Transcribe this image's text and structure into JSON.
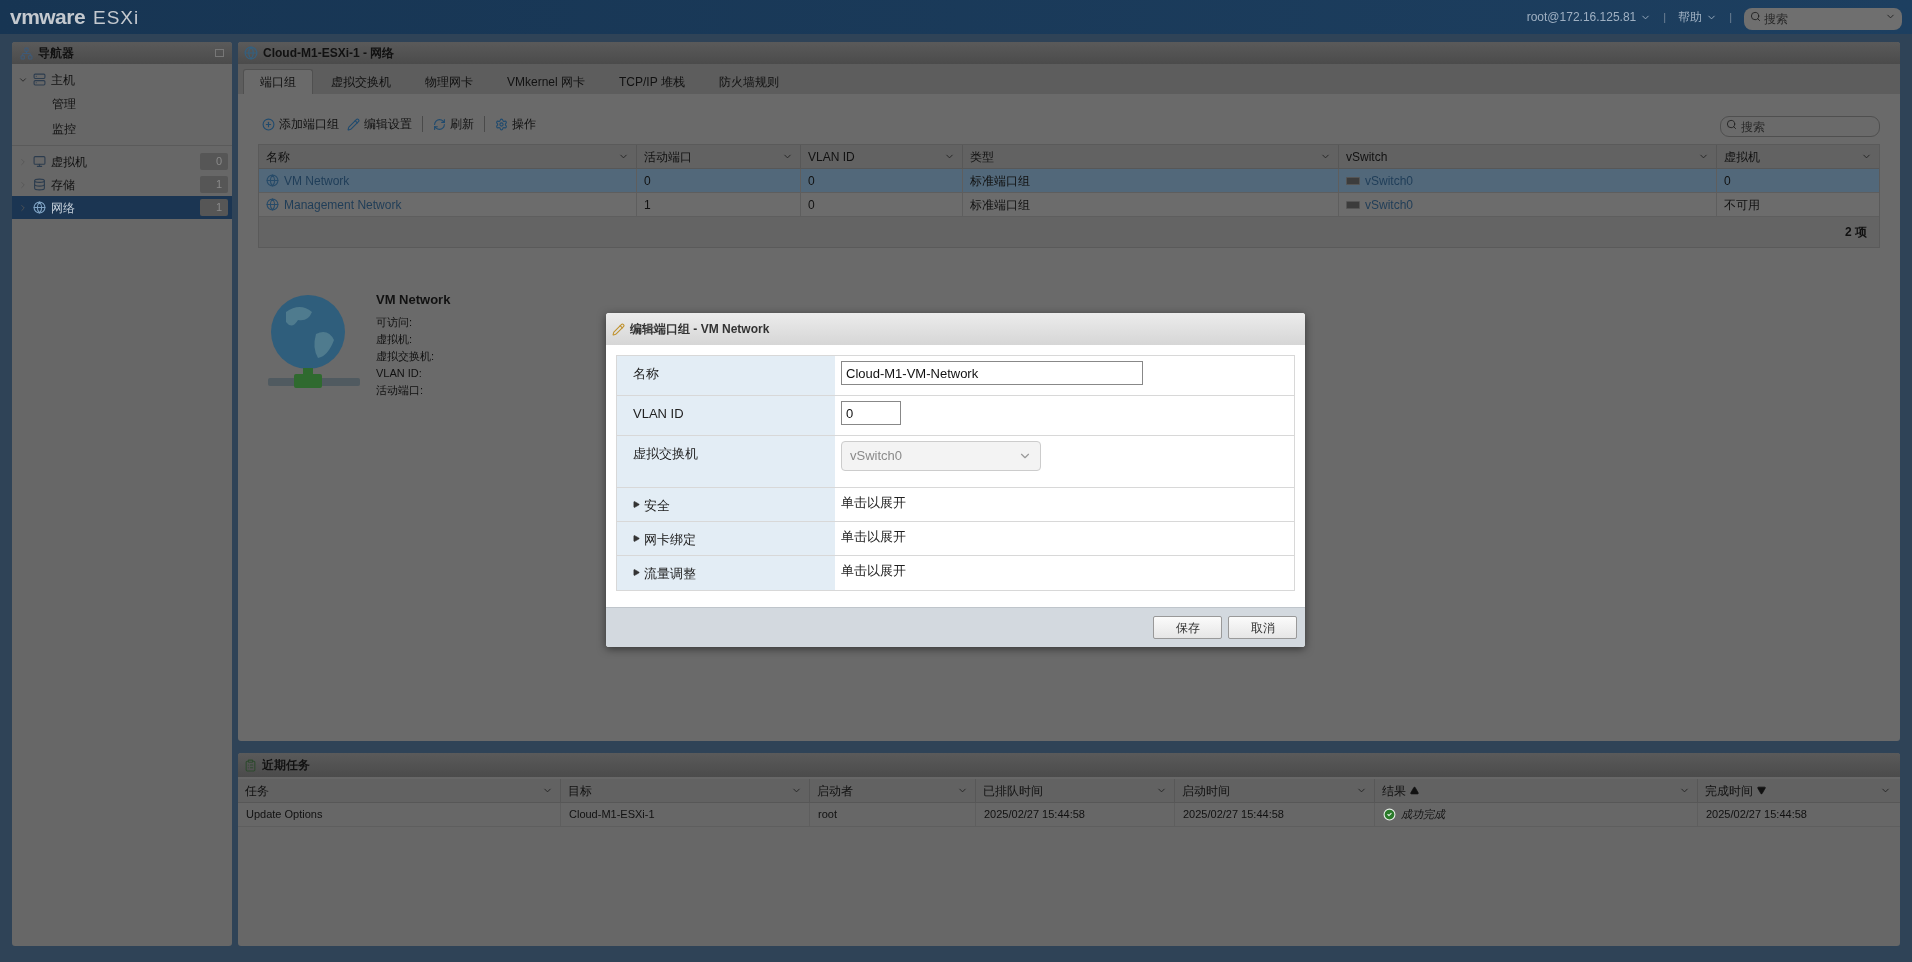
{
  "top_bar": {
    "logo": {
      "brand": "vmware",
      "product": "ESXi"
    },
    "items": [
      {
        "kind": "menu",
        "label": "root@172.16.125.81"
      },
      {
        "kind": "divider",
        "label": "|"
      },
      {
        "kind": "menu",
        "label": "帮助"
      },
      {
        "kind": "divider",
        "label": "|"
      }
    ],
    "search": {
      "placeholder": "搜索"
    }
  },
  "navigator": {
    "title": "导航器",
    "items": [
      {
        "label": "主机",
        "kind": "host",
        "expanded": true,
        "selected": false,
        "children": [
          {
            "label": "管理",
            "selected": false
          },
          {
            "label": "监控",
            "selected": false
          }
        ]
      },
      {
        "label": "虚拟机",
        "kind": "vm",
        "count": "0",
        "selected": false
      },
      {
        "label": "存储",
        "kind": "storage",
        "count": "1",
        "selected": false
      },
      {
        "label": "网络",
        "kind": "network",
        "count": "1",
        "selected": true
      }
    ]
  },
  "main": {
    "title": "Cloud-M1-ESXi-1 - 网络",
    "tabs": [
      {
        "label": "端口组",
        "selected": true
      },
      {
        "label": "虚拟交换机",
        "selected": false
      },
      {
        "label": "物理网卡",
        "selected": false
      },
      {
        "label": "VMkernel 网卡",
        "selected": false
      },
      {
        "label": "TCP/IP 堆栈",
        "selected": false
      },
      {
        "label": "防火墙规则",
        "selected": false
      }
    ],
    "toolbar": [
      {
        "kind": "add",
        "label": "添加端口组",
        "divider_before": false
      },
      {
        "kind": "edit",
        "label": "编辑设置",
        "divider_before": false
      },
      {
        "kind": "refresh",
        "label": "刷新",
        "divider_before": true
      },
      {
        "kind": "actions",
        "label": "操作",
        "divider_before": true
      }
    ],
    "search": {
      "placeholder": "搜索"
    },
    "table": {
      "columns": [
        "名称",
        "活动端口",
        "VLAN ID",
        "类型",
        "vSwitch",
        "虚拟机"
      ],
      "rows": [
        {
          "selected": true,
          "cells": [
            "VM Network",
            "0",
            "0",
            "标准端口组",
            "vSwitch0",
            "0"
          ]
        },
        {
          "selected": false,
          "cells": [
            "Management Network",
            "1",
            "0",
            "标准端口组",
            "vSwitch0",
            "不可用"
          ]
        }
      ],
      "footer": "2 项"
    },
    "detail": {
      "name": "VM Network",
      "fields": [
        "可访问:",
        "虚拟机:",
        "虚拟交换机:",
        "VLAN ID:",
        "活动端口:"
      ]
    }
  },
  "dialog": {
    "title": "编辑端口组 - VM Network",
    "rows": [
      {
        "kind": "text",
        "label": "名称",
        "value": "Cloud-M1-VM-Network"
      },
      {
        "kind": "text",
        "label": "VLAN ID",
        "value": "0"
      },
      {
        "kind": "select",
        "label": "虚拟交换机",
        "value": "vSwitch0",
        "disabled": true
      },
      {
        "kind": "section",
        "label": "安全",
        "value": "单击以展开",
        "expanded": false
      },
      {
        "kind": "section",
        "label": "网卡绑定",
        "value": "单击以展开",
        "expanded": false
      },
      {
        "kind": "section",
        "label": "流量调整",
        "value": "单击以展开",
        "expanded": false
      }
    ],
    "buttons": [
      "保存",
      "取消"
    ]
  },
  "tasks": {
    "title": "近期任务",
    "columns": [
      {
        "label": "任务",
        "sorted": false
      },
      {
        "label": "目标",
        "sorted": false
      },
      {
        "label": "启动者",
        "sorted": false
      },
      {
        "label": "已排队时间",
        "sorted": false
      },
      {
        "label": "启动时间",
        "sorted": false
      },
      {
        "label": "结果",
        "sorted": true,
        "descending": false
      },
      {
        "label": "完成时间",
        "sorted": true,
        "descending": true
      }
    ],
    "rows": [
      {
        "succeeded": true,
        "cells": [
          "Update Options",
          "Cloud-M1-ESXi-1",
          "root",
          "2025/02/27 15:44:58",
          "2025/02/27 15:44:58",
          "成功完成",
          "2025/02/27 15:44:58"
        ]
      }
    ]
  }
}
